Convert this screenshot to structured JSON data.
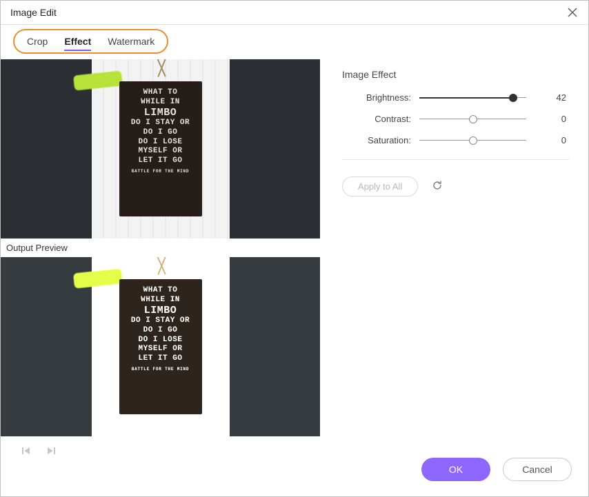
{
  "window": {
    "title": "Image Edit"
  },
  "tabs": {
    "crop": "Crop",
    "effect": "Effect",
    "watermark": "Watermark",
    "active": "effect"
  },
  "preview": {
    "output_label": "Output Preview",
    "poster_lines": [
      "WHAT TO",
      "WHILE IN",
      "LIMBO",
      "DO I STAY OR",
      "DO I GO",
      "DO I LOSE",
      "MYSELF OR",
      "LET IT GO"
    ],
    "poster_footer": "BATTLE FOR THE MIND"
  },
  "effects": {
    "section_title": "Image Effect",
    "brightness": {
      "label": "Brightness:",
      "value": 42,
      "min": -50,
      "max": 50
    },
    "contrast": {
      "label": "Contrast:",
      "value": 0,
      "min": -50,
      "max": 50
    },
    "saturation": {
      "label": "Saturation:",
      "value": 0,
      "min": -50,
      "max": 50
    },
    "apply_all": "Apply to All"
  },
  "footer": {
    "ok": "OK",
    "cancel": "Cancel"
  },
  "colors": {
    "accent": "#8d67ff",
    "highlight": "#f08c2a"
  }
}
